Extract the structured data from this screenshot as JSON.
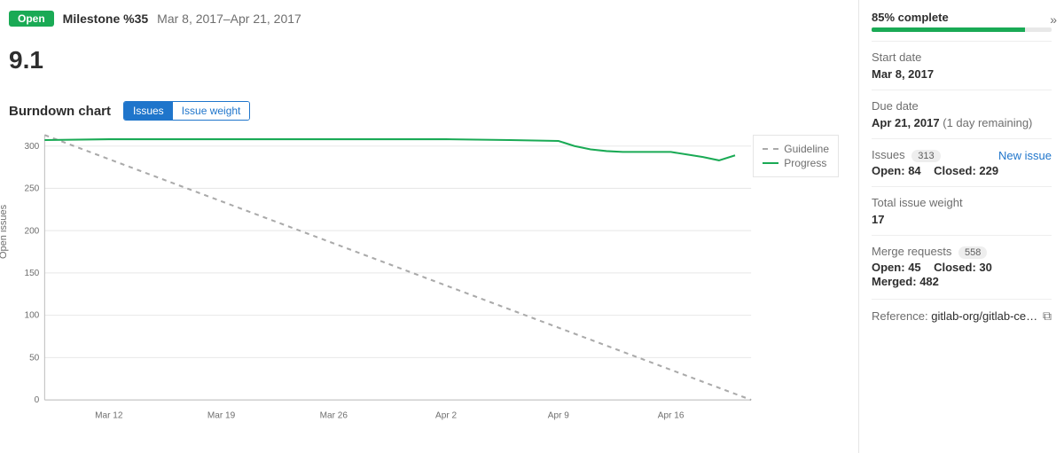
{
  "header": {
    "status_badge": "Open",
    "milestone_label": "Milestone %35",
    "date_range": "Mar 8, 2017–Apr 21, 2017"
  },
  "title": "9.1",
  "chart": {
    "title": "Burndown chart",
    "tabs": {
      "issues": "Issues",
      "weight": "Issue weight"
    },
    "y_axis_title": "Open issues",
    "legend": {
      "guideline": "Guideline",
      "progress": "Progress"
    }
  },
  "sidebar": {
    "progress": {
      "label": "85% complete",
      "percent": 85
    },
    "start_date": {
      "label": "Start date",
      "value": "Mar 8, 2017"
    },
    "due_date": {
      "label": "Due date",
      "value": "Apr 21, 2017",
      "remaining": "(1 day remaining)"
    },
    "issues": {
      "label": "Issues",
      "count": "313",
      "new_link": "New issue",
      "open_label": "Open:",
      "open": "84",
      "closed_label": "Closed:",
      "closed": "229"
    },
    "weight": {
      "label": "Total issue weight",
      "value": "17"
    },
    "mrs": {
      "label": "Merge requests",
      "count": "558",
      "open_label": "Open:",
      "open": "45",
      "closed_label": "Closed:",
      "closed": "30",
      "merged_label": "Merged:",
      "merged": "482"
    },
    "reference": {
      "label": "Reference:",
      "value": "gitlab-org/gitlab-ce…"
    }
  },
  "chart_data": {
    "type": "line",
    "ylabel": "Open issues",
    "ylim": [
      0,
      313
    ],
    "x_range": [
      "2017-03-08",
      "2017-04-21"
    ],
    "x_ticks": [
      "Mar 12",
      "Mar 19",
      "Mar 26",
      "Apr 2",
      "Apr 9",
      "Apr 16"
    ],
    "y_ticks": [
      0,
      50,
      100,
      150,
      200,
      250,
      300
    ],
    "series": [
      {
        "name": "Guideline",
        "style": "dashed",
        "color": "#aaaaaa",
        "points": [
          {
            "x": "2017-03-08",
            "y": 313
          },
          {
            "x": "2017-04-21",
            "y": 0
          }
        ]
      },
      {
        "name": "Progress",
        "style": "solid",
        "color": "#1aaa55",
        "points": [
          {
            "x": "2017-03-08",
            "y": 307
          },
          {
            "x": "2017-03-12",
            "y": 308
          },
          {
            "x": "2017-03-19",
            "y": 308
          },
          {
            "x": "2017-03-26",
            "y": 308
          },
          {
            "x": "2017-04-02",
            "y": 308
          },
          {
            "x": "2017-04-06",
            "y": 307
          },
          {
            "x": "2017-04-09",
            "y": 306
          },
          {
            "x": "2017-04-10",
            "y": 300
          },
          {
            "x": "2017-04-11",
            "y": 296
          },
          {
            "x": "2017-04-12",
            "y": 294
          },
          {
            "x": "2017-04-13",
            "y": 293
          },
          {
            "x": "2017-04-14",
            "y": 293
          },
          {
            "x": "2017-04-15",
            "y": 293
          },
          {
            "x": "2017-04-16",
            "y": 293
          },
          {
            "x": "2017-04-17",
            "y": 290
          },
          {
            "x": "2017-04-18",
            "y": 287
          },
          {
            "x": "2017-04-19",
            "y": 283
          },
          {
            "x": "2017-04-20",
            "y": 289
          }
        ]
      }
    ]
  }
}
